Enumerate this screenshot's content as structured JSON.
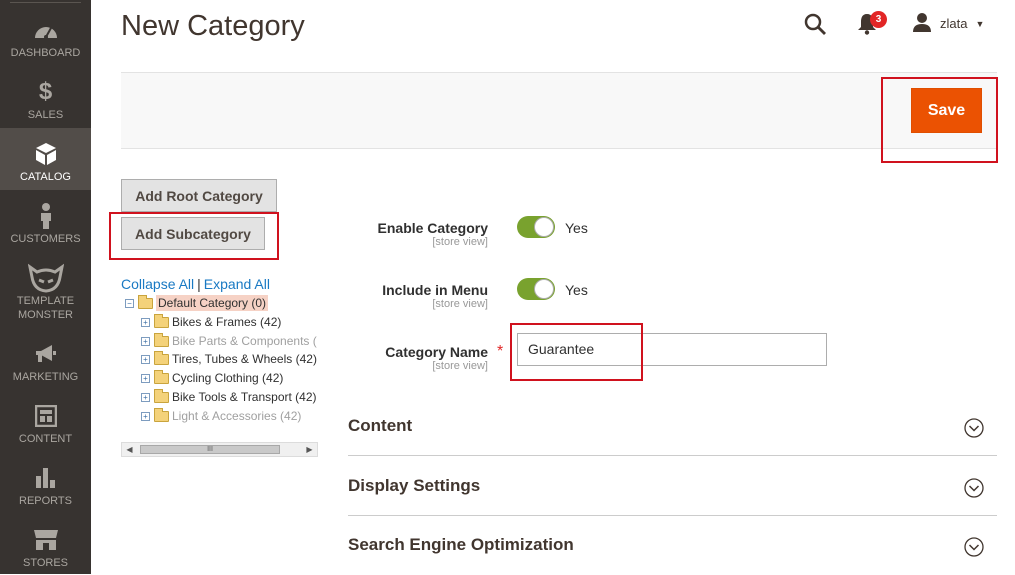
{
  "sidebar": {
    "items": [
      {
        "label": "DASHBOARD",
        "icon": "dashboard-icon"
      },
      {
        "label": "SALES",
        "icon": "dollar-icon"
      },
      {
        "label": "CATALOG",
        "icon": "box-icon",
        "active": true
      },
      {
        "label": "CUSTOMERS",
        "icon": "person-icon"
      },
      {
        "label": "TEMPLATE MONSTER",
        "icon": "monster-icon"
      },
      {
        "label": "MARKETING",
        "icon": "megaphone-icon"
      },
      {
        "label": "CONTENT",
        "icon": "layout-icon"
      },
      {
        "label": "REPORTS",
        "icon": "bar-chart-icon"
      },
      {
        "label": "STORES",
        "icon": "store-icon"
      }
    ]
  },
  "header": {
    "title": "New Category",
    "notification_count": "3",
    "username": "zlata"
  },
  "actions": {
    "save_label": "Save"
  },
  "tree_panel": {
    "add_root_label": "Add Root Category",
    "add_sub_label": "Add Subcategory",
    "collapse_label": "Collapse All",
    "separator": "|",
    "expand_label": "Expand All",
    "root": "Default Category (0)",
    "items": [
      {
        "label": "Bikes & Frames (42)",
        "enabled": true
      },
      {
        "label": "Bike Parts & Components (",
        "enabled": false
      },
      {
        "label": "Tires, Tubes & Wheels (42)",
        "enabled": true
      },
      {
        "label": "Cycling Clothing (42)",
        "enabled": true
      },
      {
        "label": "Bike Tools & Transport (42)",
        "enabled": true
      },
      {
        "label": "Light & Accessories (42)",
        "enabled": false
      }
    ],
    "scroll_grip": "III"
  },
  "form": {
    "enable_category": {
      "label": "Enable Category",
      "scope": "[store view]",
      "value": "Yes",
      "on": true
    },
    "include_in_menu": {
      "label": "Include in Menu",
      "scope": "[store view]",
      "value": "Yes",
      "on": true
    },
    "category_name": {
      "label": "Category Name",
      "scope": "[store view]",
      "required_mark": "*",
      "value": "Guarantee"
    }
  },
  "sections": [
    {
      "title": "Content"
    },
    {
      "title": "Display Settings"
    },
    {
      "title": "Search Engine Optimization"
    }
  ],
  "colors": {
    "sidebar_bg": "#373330",
    "save_button": "#eb5202",
    "toggle_on": "#79a22e",
    "highlight_box": "#d0121e",
    "link": "#1979c3"
  }
}
